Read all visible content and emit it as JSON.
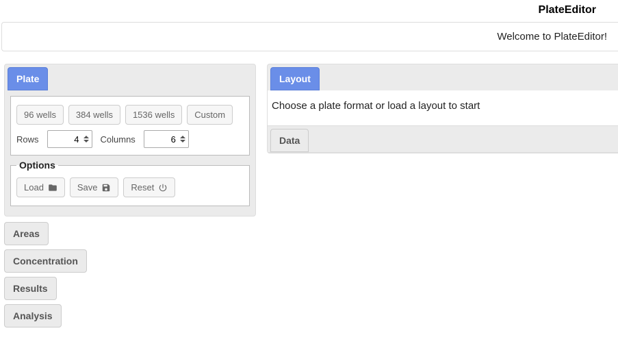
{
  "app": {
    "title": "PlateEditor",
    "welcome": "Welcome to PlateEditor!"
  },
  "left": {
    "tabs": {
      "plate": "Plate",
      "areas": "Areas",
      "concentration": "Concentration",
      "results": "Results",
      "analysis": "Analysis"
    },
    "plate": {
      "formats": {
        "w96": "96 wells",
        "w384": "384 wells",
        "w1536": "1536 wells",
        "custom": "Custom"
      },
      "rows_label": "Rows",
      "rows_value": "4",
      "cols_label": "Columns",
      "cols_value": "6",
      "options_legend": "Options",
      "load_label": "Load",
      "save_label": "Save",
      "reset_label": "Reset"
    }
  },
  "right": {
    "layout_tab": "Layout",
    "layout_hint": "Choose a plate format or load a layout to start",
    "data_tab": "Data"
  }
}
